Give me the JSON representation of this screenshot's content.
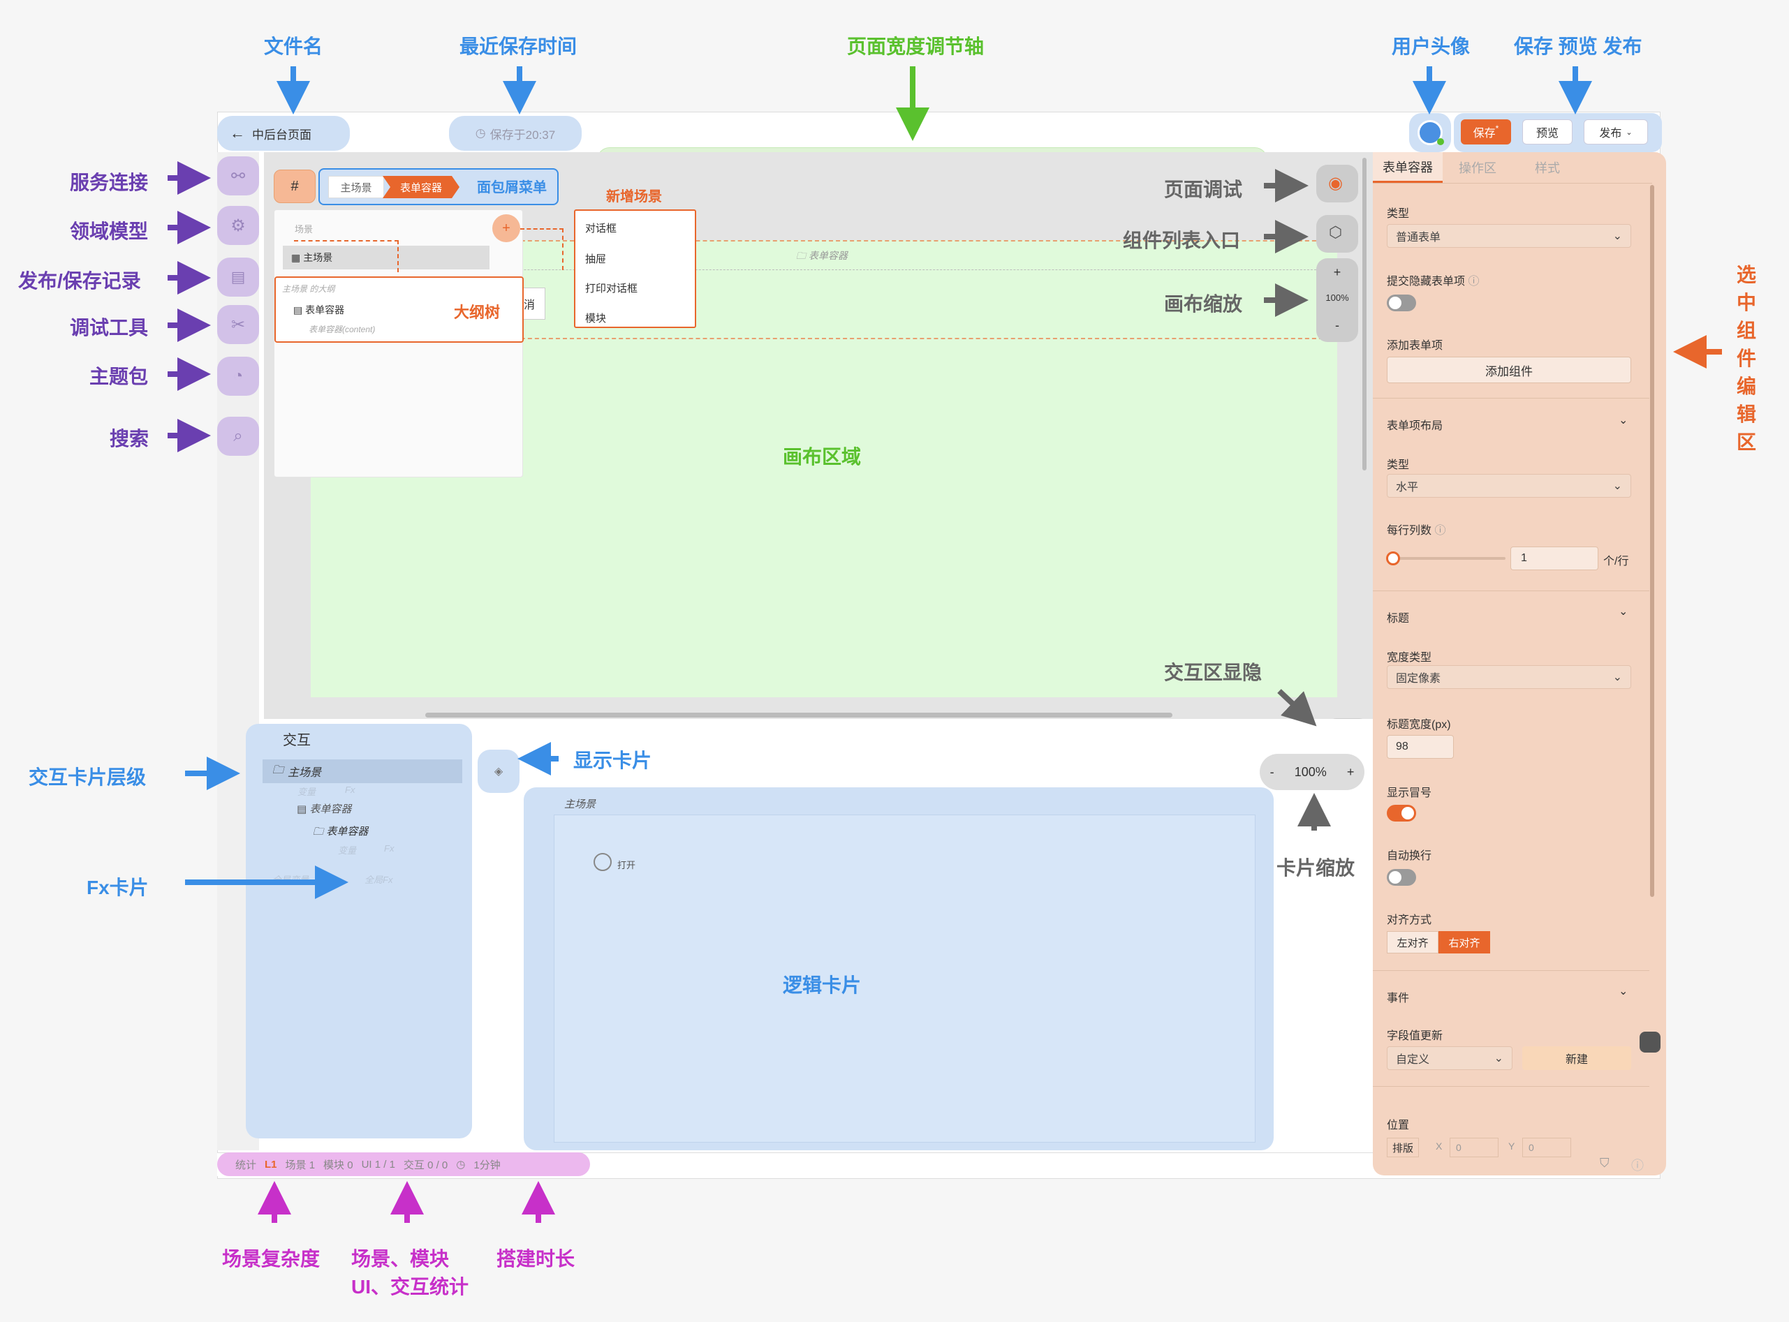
{
  "annotations": {
    "file_name": "文件名",
    "last_saved": "最近保存时间",
    "width_axis": "页面宽度调节轴",
    "user_avatar": "用户头像",
    "save_preview_publish": "保存 预览 发布",
    "service_conn": "服务连接",
    "domain_model": "领域模型",
    "publish_record": "发布/保存记录",
    "debug_tool": "调试工具",
    "theme_pkg": "主题包",
    "search": "搜索",
    "page_debug": "页面调试",
    "component_list": "组件列表入口",
    "canvas_zoom": "画布缩放",
    "interaction_toggle": "交互区显隐",
    "card_zoom": "卡片缩放",
    "show_card": "显示卡片",
    "breadcrumb": "面包屑菜单",
    "new_scene": "新增场景",
    "outline_tree": "大纲树",
    "canvas_area": "画布区域",
    "logic_card": "逻辑卡片",
    "card_hierarchy": "交互卡片层级",
    "fx_card": "Fx卡片",
    "editor_area": "选中组件编辑区",
    "complexity": "场景复杂度",
    "stats_1": "场景、模块",
    "stats_2": "UI、交互统计",
    "build_time": "搭建时长"
  },
  "colors": {
    "blue": "#3a8ee6",
    "purple": "#6a3fb0",
    "orange": "#e8662c",
    "green": "#5ac12e",
    "magenta": "#c730c9",
    "gray": "#666666"
  },
  "header": {
    "back_label": "中后台页面",
    "saved_text": "保存于20:37",
    "save_label": "保存",
    "save_mark": "*",
    "preview_label": "预览",
    "publish_label": "发布"
  },
  "breadcrumb": {
    "hash": "#",
    "item1": "主场景",
    "item2": "表单容器"
  },
  "new_scene_menu": [
    "对话框",
    "抽屉",
    "打印对话框",
    "模块"
  ],
  "outline": {
    "search_ph": "场景",
    "root": "主场景",
    "sub_title": "主场景 的大纲",
    "node": "表单容器",
    "node_sub": "表单容器(content)"
  },
  "canvas": {
    "container_label": "表单容器",
    "zoom_plus": "+",
    "zoom_value": "100%",
    "zoom_minus": "-",
    "partial": "消"
  },
  "interaction": {
    "title": "交互",
    "root": "主场景",
    "var1": "变量",
    "fx1": "Fx",
    "container": "表单容器",
    "container2": "表单容器",
    "var2": "变量",
    "fx2": "Fx",
    "global_var": "全局变量",
    "global_fx": "全局Fx",
    "card_scene": "主场景",
    "open_label": "打开",
    "zoom_minus": "-",
    "zoom_value": "100%",
    "zoom_plus": "+"
  },
  "right_panel": {
    "tabs": [
      "表单容器",
      "操作区",
      "样式"
    ],
    "type_label": "类型",
    "type_value": "普通表单",
    "hidden_label": "提交隐藏表单项",
    "add_item_label": "添加表单项",
    "add_btn": "添加组件",
    "layout_section": "表单项布局",
    "layout_type_label": "类型",
    "layout_type_value": "水平",
    "cols_label": "每行列数",
    "cols_value": "1",
    "cols_unit": "个/行",
    "title_section": "标题",
    "width_type_label": "宽度类型",
    "width_type_value": "固定像素",
    "title_width_label": "标题宽度(px)",
    "title_width_value": "98",
    "colon_label": "显示冒号",
    "wrap_label": "自动换行",
    "align_label": "对齐方式",
    "align_left": "左对齐",
    "align_right": "右对齐",
    "events_section": "事件",
    "field_update_label": "字段值更新",
    "custom_value": "自定义",
    "new_btn": "新建",
    "position_label": "位置",
    "layout_btn": "排版",
    "x_label": "X",
    "x_value": "0",
    "y_label": "Y",
    "y_value": "0"
  },
  "status": {
    "stats": "统计",
    "level": "L1",
    "scene": "场景 1",
    "module": "模块 0",
    "ui": "UI 1 / 1",
    "interaction": "交互 0 / 0",
    "time": "1分钟"
  }
}
